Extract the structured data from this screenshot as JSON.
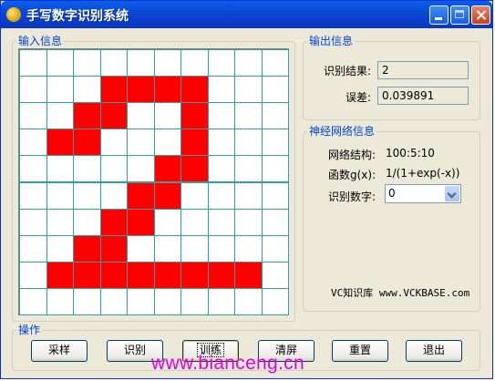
{
  "window": {
    "title": "手写数字识别系统"
  },
  "input_group": {
    "label": "输入信息",
    "grid": [
      [
        0,
        0,
        0,
        0,
        0,
        0,
        0,
        0,
        0,
        0
      ],
      [
        0,
        0,
        0,
        1,
        1,
        1,
        1,
        0,
        0,
        0
      ],
      [
        0,
        0,
        1,
        1,
        0,
        0,
        1,
        0,
        0,
        0
      ],
      [
        0,
        1,
        1,
        0,
        0,
        0,
        1,
        0,
        0,
        0
      ],
      [
        0,
        0,
        0,
        0,
        0,
        1,
        1,
        0,
        0,
        0
      ],
      [
        0,
        0,
        0,
        0,
        1,
        1,
        0,
        0,
        0,
        0
      ],
      [
        0,
        0,
        0,
        1,
        1,
        0,
        0,
        0,
        0,
        0
      ],
      [
        0,
        0,
        1,
        1,
        0,
        0,
        0,
        0,
        0,
        0
      ],
      [
        0,
        1,
        1,
        1,
        1,
        1,
        1,
        1,
        1,
        0
      ],
      [
        0,
        0,
        0,
        0,
        0,
        0,
        0,
        0,
        0,
        0
      ]
    ]
  },
  "output_group": {
    "label": "输出信息",
    "result_label": "识别结果:",
    "result_value": "2",
    "error_label": "误差:",
    "error_value": "0.039891"
  },
  "nn_group": {
    "label": "神经网络信息",
    "structure_label": "网络结构:",
    "structure_value": "100:5:10",
    "func_label": "函数g(x):",
    "func_value": "1/(1+exp(-x))",
    "digit_label": "识别数字:",
    "digit_value": "0"
  },
  "credit": "VC知识库 www.VCKBASE.com",
  "ops_group": {
    "label": "操作",
    "buttons": [
      "采样",
      "识别",
      "训练",
      "清屏",
      "重置",
      "退出"
    ]
  },
  "watermark": "www.bianceng.cn",
  "colors": {
    "cell_on": "#ff0000",
    "grid_line": "#2ea0a0",
    "group_label": "#0046d5",
    "title_bar": "#0b3fcf"
  }
}
